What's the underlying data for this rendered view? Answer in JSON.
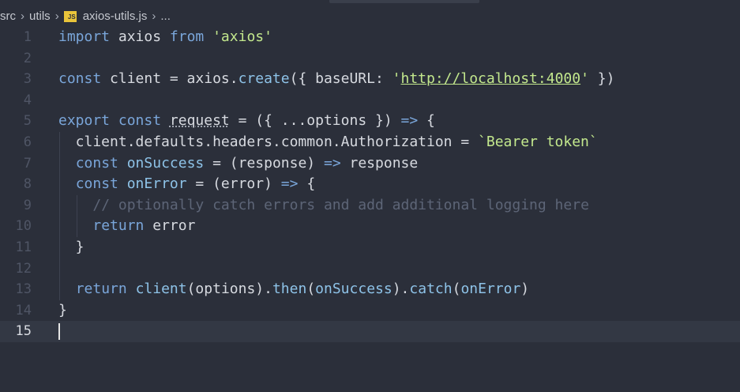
{
  "breadcrumb": {
    "segments": [
      "src",
      "utils",
      "axios-utils.js",
      "..."
    ],
    "file_badge": "JS"
  },
  "editor": {
    "current_line": 15,
    "lines": [
      {
        "n": "1",
        "parts": [
          [
            "kw",
            "import"
          ],
          [
            "punc",
            " axios "
          ],
          [
            "kw",
            "from"
          ],
          [
            "punc",
            " "
          ],
          [
            "str",
            "'axios'"
          ]
        ]
      },
      {
        "n": "2",
        "parts": []
      },
      {
        "n": "3",
        "parts": [
          [
            "kw",
            "const"
          ],
          [
            "punc",
            " client = axios."
          ],
          [
            "fn",
            "create"
          ],
          [
            "punc",
            "({ baseURL: "
          ],
          [
            "str",
            "'"
          ],
          [
            "str-u",
            "http://localhost:4000"
          ],
          [
            "str",
            "'"
          ],
          [
            "punc",
            " })"
          ]
        ]
      },
      {
        "n": "4",
        "parts": []
      },
      {
        "n": "5",
        "parts": [
          [
            "kw",
            "export"
          ],
          [
            "punc",
            " "
          ],
          [
            "kw",
            "const"
          ],
          [
            "punc",
            " "
          ],
          [
            "dotted",
            "request"
          ],
          [
            "punc",
            " = ({ ...options }) "
          ],
          [
            "kw",
            "=>"
          ],
          [
            "punc",
            " {"
          ]
        ]
      },
      {
        "n": "6",
        "parts": [
          [
            "punc",
            "  client.defaults.headers.common.Authorization = "
          ],
          [
            "str",
            "`Bearer token`"
          ]
        ]
      },
      {
        "n": "7",
        "parts": [
          [
            "punc",
            "  "
          ],
          [
            "kw",
            "const"
          ],
          [
            "punc",
            " "
          ],
          [
            "fn",
            "onSuccess"
          ],
          [
            "punc",
            " = (response) "
          ],
          [
            "kw",
            "=>"
          ],
          [
            "punc",
            " response"
          ]
        ]
      },
      {
        "n": "8",
        "parts": [
          [
            "punc",
            "  "
          ],
          [
            "kw",
            "const"
          ],
          [
            "punc",
            " "
          ],
          [
            "fn",
            "onError"
          ],
          [
            "punc",
            " = (error) "
          ],
          [
            "kw",
            "=>"
          ],
          [
            "punc",
            " {"
          ]
        ]
      },
      {
        "n": "9",
        "parts": [
          [
            "punc",
            "    "
          ],
          [
            "cm",
            "// optionally catch errors and add additional logging here"
          ]
        ]
      },
      {
        "n": "10",
        "parts": [
          [
            "punc",
            "    "
          ],
          [
            "kw",
            "return"
          ],
          [
            "punc",
            " error"
          ]
        ]
      },
      {
        "n": "11",
        "parts": [
          [
            "punc",
            "  }"
          ]
        ]
      },
      {
        "n": "12",
        "parts": []
      },
      {
        "n": "13",
        "parts": [
          [
            "punc",
            "  "
          ],
          [
            "kw",
            "return"
          ],
          [
            "punc",
            " "
          ],
          [
            "fn",
            "client"
          ],
          [
            "punc",
            "(options)."
          ],
          [
            "fn",
            "then"
          ],
          [
            "punc",
            "("
          ],
          [
            "fn",
            "onSuccess"
          ],
          [
            "punc",
            ")."
          ],
          [
            "fn",
            "catch"
          ],
          [
            "punc",
            "("
          ],
          [
            "fn",
            "onError"
          ],
          [
            "punc",
            ")"
          ]
        ]
      },
      {
        "n": "14",
        "parts": [
          [
            "punc",
            "}"
          ]
        ]
      },
      {
        "n": "15",
        "parts": []
      }
    ]
  }
}
